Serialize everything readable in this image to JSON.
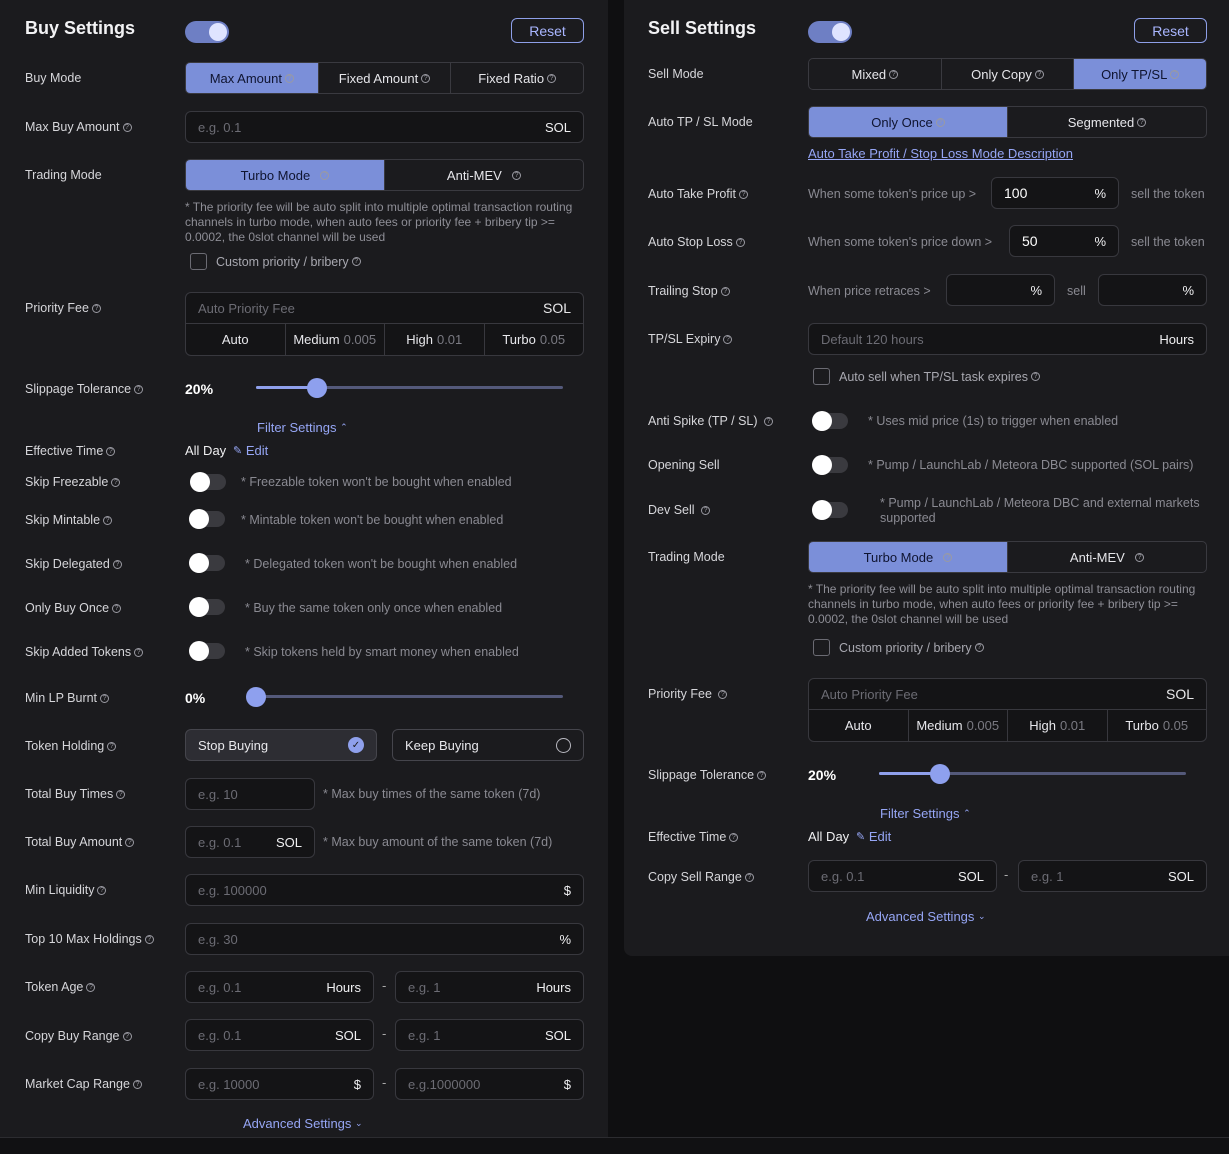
{
  "buy": {
    "title": "Buy Settings",
    "reset": "Reset",
    "buy_mode": {
      "label": "Buy Mode",
      "options": [
        "Max Amount",
        "Fixed Amount",
        "Fixed Ratio"
      ],
      "active": "Max Amount"
    },
    "max_buy_amount": {
      "label": "Max Buy Amount",
      "placeholder": "e.g. 0.1",
      "unit": "SOL"
    },
    "trading_mode": {
      "label": "Trading Mode",
      "options": [
        "Turbo Mode",
        "Anti-MEV"
      ],
      "active": "Turbo Mode"
    },
    "trading_note": "* The priority fee will be auto split into multiple optimal transaction routing channels in turbo mode, when auto fees or priority fee + bribery tip >= 0.0002, the 0slot channel will be used",
    "custom_priority": "Custom priority / bribery",
    "priority_fee": {
      "label": "Priority Fee",
      "placeholder": "Auto Priority Fee",
      "unit": "SOL",
      "presets": [
        {
          "name": "Auto",
          "value": ""
        },
        {
          "name": "Medium",
          "value": "0.005"
        },
        {
          "name": "High",
          "value": "0.01"
        },
        {
          "name": "Turbo",
          "value": "0.05"
        }
      ]
    },
    "slippage": {
      "label": "Slippage Tolerance",
      "value": "20%",
      "fraction": 0.2
    },
    "filter_settings": "Filter Settings",
    "effective_time": {
      "label": "Effective Time",
      "value": "All Day",
      "edit": "Edit"
    },
    "skip_freezable": {
      "label": "Skip Freezable",
      "note": "* Freezable token won't be bought when enabled"
    },
    "skip_mintable": {
      "label": "Skip Mintable",
      "note": "* Mintable token won't be bought when enabled"
    },
    "skip_delegated": {
      "label": "Skip Delegated",
      "note": "* Delegated token won't be bought when enabled"
    },
    "only_buy_once": {
      "label": "Only Buy Once",
      "note": "* Buy the same token only once when enabled"
    },
    "skip_added": {
      "label": "Skip Added Tokens",
      "note": "* Skip tokens held by smart money when enabled"
    },
    "min_lp_burnt": {
      "label": "Min LP Burnt",
      "value": "0%",
      "fraction": 0
    },
    "token_holding": {
      "label": "Token Holding",
      "options": [
        "Stop Buying",
        "Keep Buying"
      ],
      "active": "Stop Buying"
    },
    "total_buy_times": {
      "label": "Total Buy Times",
      "placeholder": "e.g. 10",
      "note": "* Max buy times of the same token (7d)"
    },
    "total_buy_amount": {
      "label": "Total Buy Amount",
      "placeholder": "e.g. 0.1",
      "unit": "SOL",
      "note": "* Max buy amount of the same token (7d)"
    },
    "min_liquidity": {
      "label": "Min Liquidity",
      "placeholder": "e.g. 100000",
      "unit": "$"
    },
    "top10": {
      "label": "Top 10 Max Holdings",
      "placeholder": "e.g. 30",
      "unit": "%"
    },
    "token_age": {
      "label": "Token Age",
      "min_placeholder": "e.g. 0.1",
      "max_placeholder": "e.g. 1",
      "unit": "Hours"
    },
    "copy_buy_range": {
      "label": "Copy Buy Range",
      "min_placeholder": "e.g. 0.1",
      "max_placeholder": "e.g. 1",
      "unit": "SOL"
    },
    "market_cap": {
      "label": "Market Cap Range",
      "min_placeholder": "e.g. 10000",
      "max_placeholder": "e.g.1000000",
      "unit": "$"
    },
    "advanced": "Advanced Settings"
  },
  "sell": {
    "title": "Sell Settings",
    "reset": "Reset",
    "sell_mode": {
      "label": "Sell Mode",
      "options": [
        "Mixed",
        "Only Copy",
        "Only TP/SL"
      ],
      "active": "Only TP/SL"
    },
    "auto_tpsl_mode": {
      "label": "Auto TP / SL Mode",
      "options": [
        "Only Once",
        "Segmented"
      ],
      "active": "Only Once"
    },
    "tpsl_desc_link": "Auto Take Profit / Stop Loss Mode Description",
    "take_profit": {
      "label": "Auto Take Profit",
      "prefix": "When some token's price up >",
      "value": "100",
      "unit": "%",
      "suffix": "sell the token"
    },
    "stop_loss": {
      "label": "Auto Stop Loss",
      "prefix": "When some token's price down >",
      "value": "50",
      "unit": "%",
      "suffix": "sell the token"
    },
    "trailing_stop": {
      "label": "Trailing Stop",
      "prefix": "When price retraces >",
      "unit": "%",
      "mid": "sell",
      "unit2": "%"
    },
    "tpsl_expiry": {
      "label": "TP/SL Expiry",
      "placeholder": "Default 120 hours",
      "unit": "Hours"
    },
    "auto_sell_expire": "Auto sell when TP/SL task expires",
    "anti_spike": {
      "label": "Anti Spike (TP / SL)",
      "note": "* Uses mid price (1s) to trigger when enabled"
    },
    "opening_sell": {
      "label": "Opening Sell",
      "note": "* Pump / LaunchLab / Meteora DBC supported (SOL pairs)"
    },
    "dev_sell": {
      "label": "Dev Sell",
      "note": "* Pump / LaunchLab / Meteora DBC and external markets supported"
    },
    "trading_mode": {
      "label": "Trading Mode",
      "options": [
        "Turbo Mode",
        "Anti-MEV"
      ],
      "active": "Turbo Mode"
    },
    "trading_note": "* The priority fee will be auto split into multiple optimal transaction routing channels in turbo mode, when auto fees or priority fee + bribery tip >= 0.0002, the 0slot channel will be used",
    "custom_priority": "Custom priority / bribery",
    "priority_fee": {
      "label": "Priority Fee",
      "placeholder": "Auto Priority Fee",
      "unit": "SOL",
      "presets": [
        {
          "name": "Auto",
          "value": ""
        },
        {
          "name": "Medium",
          "value": "0.005"
        },
        {
          "name": "High",
          "value": "0.01"
        },
        {
          "name": "Turbo",
          "value": "0.05"
        }
      ]
    },
    "slippage": {
      "label": "Slippage Tolerance",
      "value": "20%",
      "fraction": 0.2
    },
    "filter_settings": "Filter Settings",
    "effective_time": {
      "label": "Effective Time",
      "value": "All Day",
      "edit": "Edit"
    },
    "copy_sell_range": {
      "label": "Copy Sell Range",
      "min_placeholder": "e.g. 0.1",
      "max_placeholder": "e.g. 1",
      "unit": "SOL"
    },
    "advanced": "Advanced Settings"
  },
  "colors": {
    "accent": "#7b8fd9",
    "link": "#96a6f5",
    "panel": "#1b1b1e"
  }
}
